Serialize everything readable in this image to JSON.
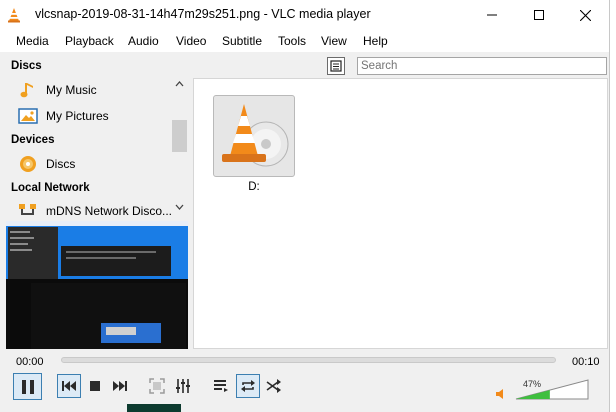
{
  "window": {
    "title": "vlcsnap-2019-08-31-14h47m29s251.png - VLC media player"
  },
  "menu": [
    "Media",
    "Playback",
    "Audio",
    "Video",
    "Subtitle",
    "Tools",
    "View",
    "Help"
  ],
  "sidebar": {
    "sections": [
      {
        "title": "Discs",
        "items": [
          {
            "label": "My Music",
            "icon": "music-note-icon"
          },
          {
            "label": "My Pictures",
            "icon": "pictures-icon"
          }
        ]
      },
      {
        "title": "Devices",
        "items": [
          {
            "label": "Discs",
            "icon": "disc-icon"
          }
        ]
      },
      {
        "title": "Local Network",
        "items": [
          {
            "label": "mDNS Network Disco...",
            "icon": "network-icon"
          }
        ]
      }
    ]
  },
  "search": {
    "placeholder": "Search"
  },
  "tile": {
    "label": "D:"
  },
  "playback": {
    "time_elapsed": "00:00",
    "time_total": "00:10",
    "progress": 0
  },
  "volume": {
    "percent_label": "47%",
    "level": 0.47
  },
  "colors": {
    "accent": "#3c7fb1",
    "vlc_orange": "#f28a1a",
    "volume_green": "#3fbf3f",
    "preview_blue": "#0a6fd8"
  }
}
